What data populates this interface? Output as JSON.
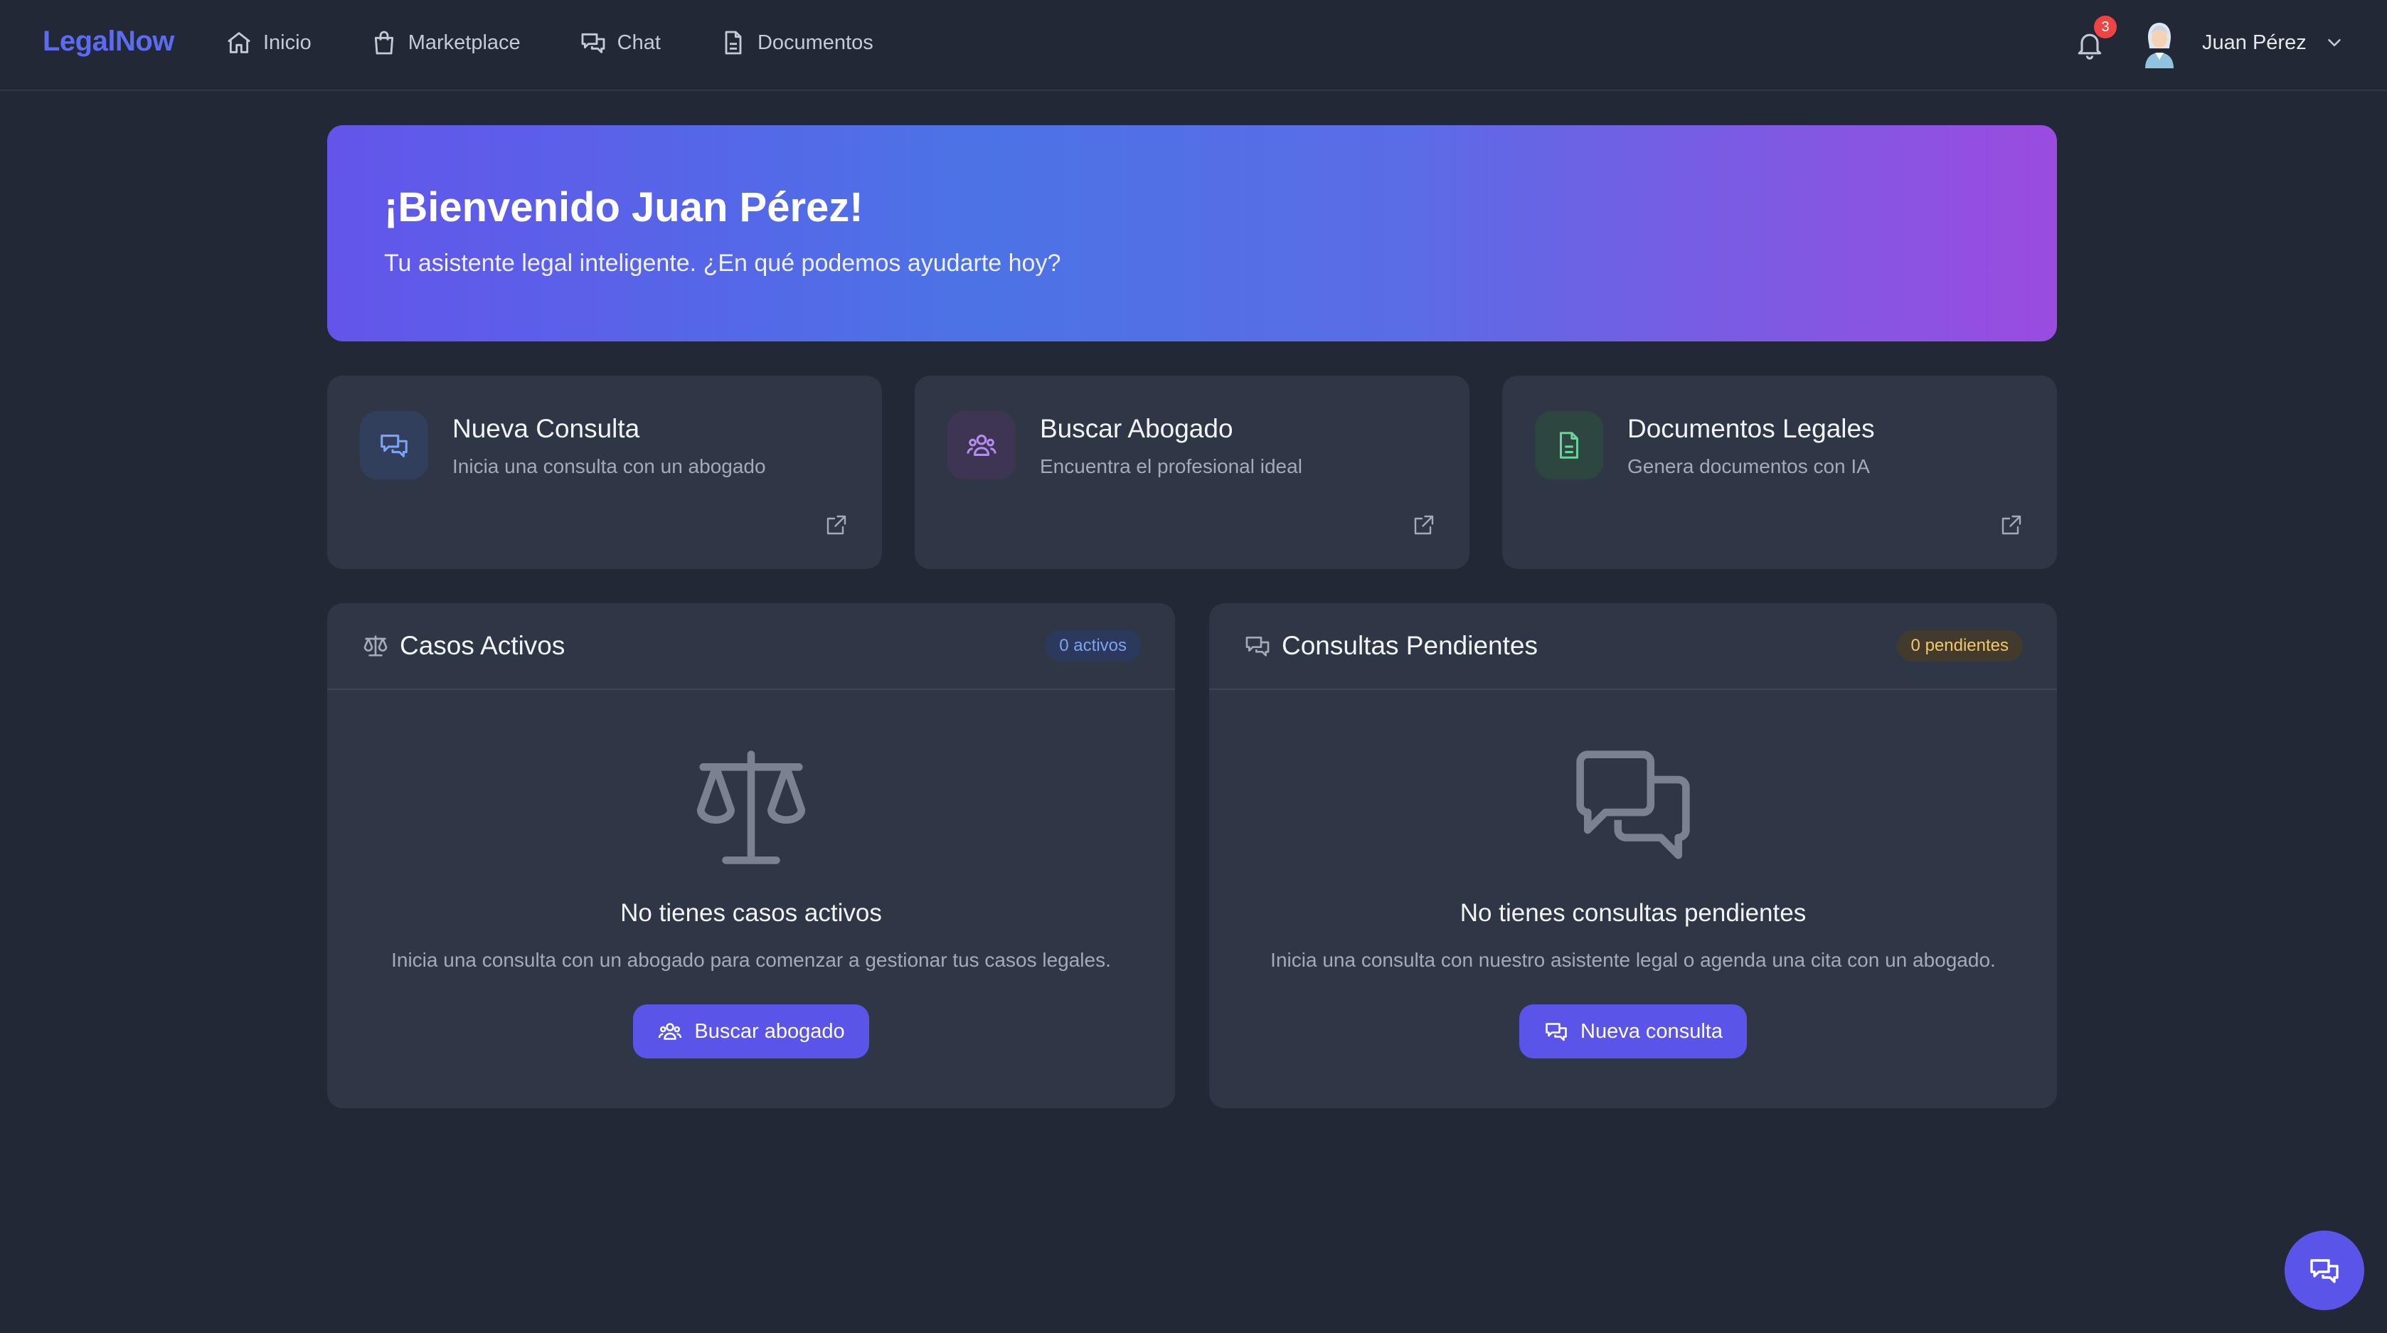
{
  "app": {
    "logo": "LegalNow"
  },
  "nav": {
    "items": [
      {
        "label": "Inicio",
        "icon": "home-icon"
      },
      {
        "label": "Marketplace",
        "icon": "shopping-bag-icon"
      },
      {
        "label": "Chat",
        "icon": "chat-icon"
      },
      {
        "label": "Documentos",
        "icon": "document-icon"
      }
    ]
  },
  "header": {
    "notifications_count": "3",
    "user_name": "Juan Pérez"
  },
  "banner": {
    "title": "¡Bienvenido Juan Pérez!",
    "subtitle": "Tu asistente legal inteligente. ¿En qué podemos ayudarte hoy?"
  },
  "actions": [
    {
      "title": "Nueva Consulta",
      "subtitle": "Inicia una consulta con un abogado",
      "icon": "chat-icon",
      "color": "#7ea2f5"
    },
    {
      "title": "Buscar Abogado",
      "subtitle": "Encuentra el profesional ideal",
      "icon": "users-icon",
      "color": "#b58cf0"
    },
    {
      "title": "Documentos Legales",
      "subtitle": "Genera documentos con IA",
      "icon": "document-icon",
      "color": "#6ad49a"
    }
  ],
  "cases": {
    "title": "Casos Activos",
    "badge": "0 activos",
    "empty_title": "No tienes casos activos",
    "empty_text": "Inicia una consulta con un abogado para comenzar a gestionar tus casos legales.",
    "button": "Buscar abogado"
  },
  "consultations": {
    "title": "Consultas Pendientes",
    "badge": "0 pendientes",
    "empty_title": "No tienes consultas pendientes",
    "empty_text": "Inicia una consulta con nuestro asistente legal o agenda una cita con un abogado.",
    "button": "Nueva consulta"
  },
  "colors": {
    "background": "#222836",
    "card": "#2f3645",
    "accent": "#5a55e8",
    "brand": "#5b6cf0"
  }
}
